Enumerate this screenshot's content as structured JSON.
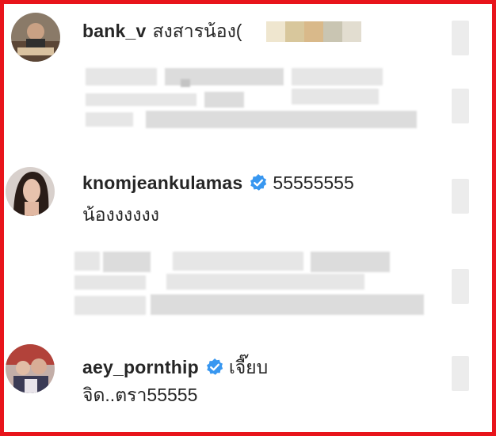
{
  "comments": [
    {
      "username": "bank_v",
      "verified": false,
      "text": "สงสารน้อง(",
      "line2": ""
    },
    {
      "username": "knomjeankulamas",
      "verified": true,
      "text": "55555555",
      "line2": "น้องงงงงง"
    },
    {
      "username": "aey_pornthip",
      "verified": true,
      "text": "เจี๊ยบ",
      "line2": "จิด..ตรา55555"
    }
  ],
  "colors": {
    "frame": "#e8141b",
    "verified": "#3897f0",
    "text": "#262626"
  },
  "icons": {
    "verified": "verified-badge-icon"
  }
}
